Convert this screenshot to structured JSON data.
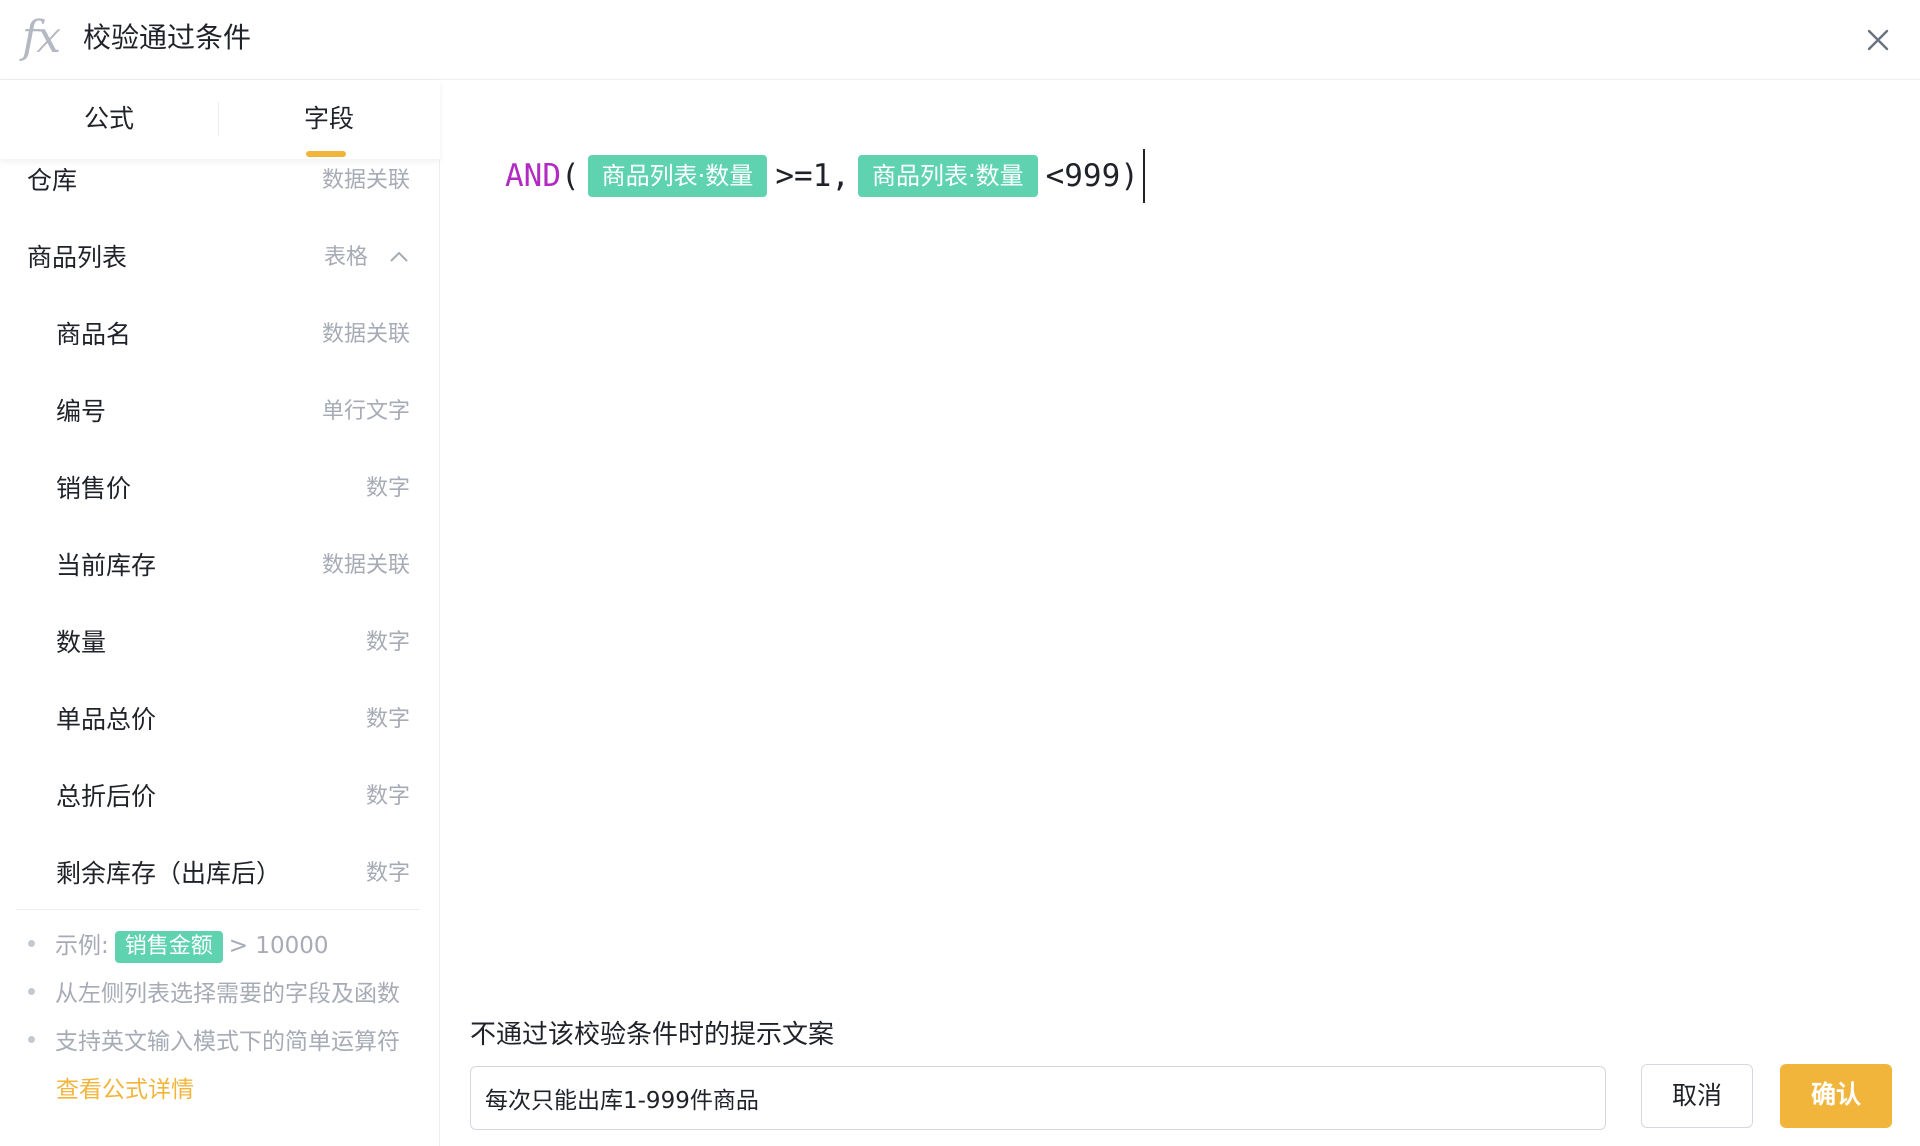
{
  "header": {
    "icon": "fx-icon",
    "title": "校验通过条件"
  },
  "tabs": [
    {
      "label": "公式"
    },
    {
      "label": "字段"
    }
  ],
  "fields": [
    {
      "name": "仓库",
      "type": "数据关联",
      "indent": false
    },
    {
      "name": "商品列表",
      "type": "表格",
      "indent": false,
      "expanded": true
    },
    {
      "name": "商品名",
      "type": "数据关联",
      "indent": true
    },
    {
      "name": "编号",
      "type": "单行文字",
      "indent": true
    },
    {
      "name": "销售价",
      "type": "数字",
      "indent": true
    },
    {
      "name": "当前库存",
      "type": "数据关联",
      "indent": true
    },
    {
      "name": "数量",
      "type": "数字",
      "indent": true
    },
    {
      "name": "单品总价",
      "type": "数字",
      "indent": true
    },
    {
      "name": "总折后价",
      "type": "数字",
      "indent": true
    },
    {
      "name": "剩余库存（出库后）",
      "type": "数字",
      "indent": true
    }
  ],
  "hints": {
    "example_prefix": "示例:",
    "example_chip": "销售金额",
    "example_suffix": "> 10000",
    "hint2": "从左侧列表选择需要的字段及函数",
    "hint3": "支持英文输入模式下的简单运算符",
    "detail_link": "查看公式详情"
  },
  "formula": {
    "fn": "AND",
    "open_paren": "(",
    "token1": "商品列表·数量",
    "op1": ">=1,",
    "token2": "商品列表·数量",
    "op2": "<999)"
  },
  "message": {
    "label": "不通过该校验条件时的提示文案",
    "value": "每次只能出库1-999件商品"
  },
  "buttons": {
    "cancel": "取消",
    "confirm": "确认"
  },
  "colors": {
    "accent": "#f2b53c",
    "token": "#5fd3b0",
    "function": "#b12ac2"
  }
}
